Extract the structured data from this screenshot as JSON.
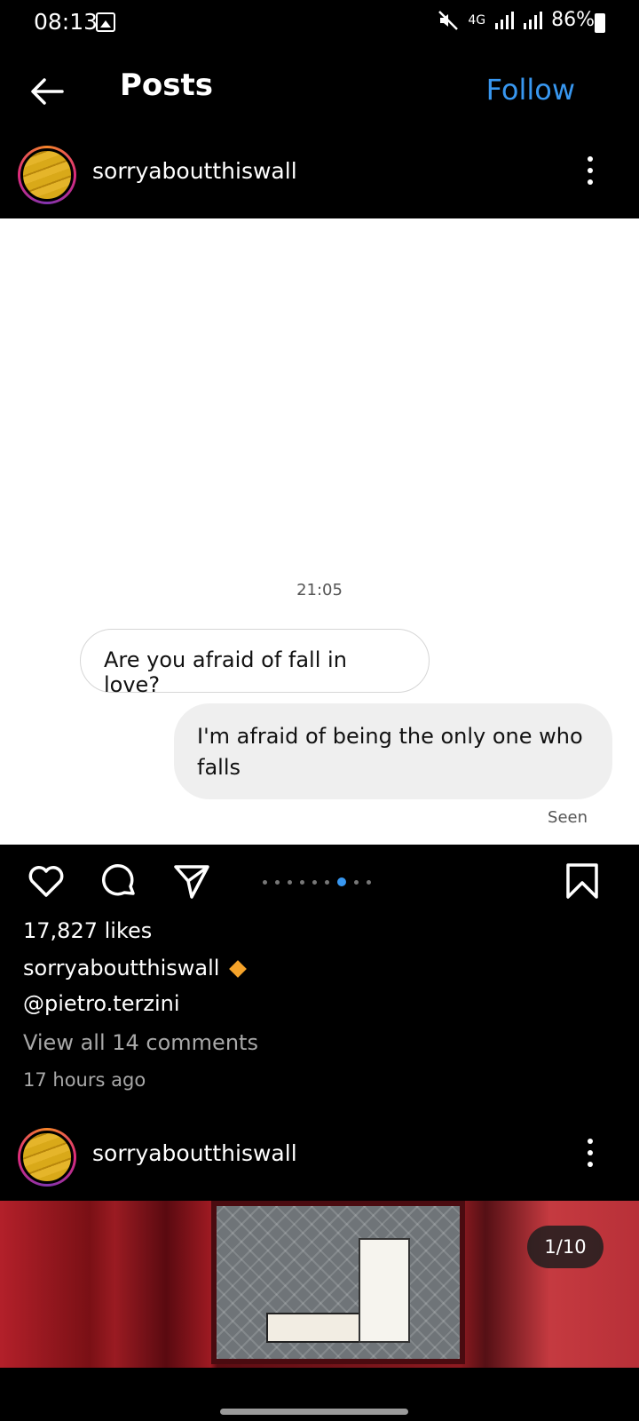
{
  "status_bar": {
    "time": "08:13",
    "network": "4G",
    "battery": "86%"
  },
  "header": {
    "title": "Posts",
    "follow_label": "Follow"
  },
  "post": {
    "username": "sorryaboutthiswall",
    "chat": {
      "time": "21:05",
      "message_left": "Are you afraid of fall in love?",
      "message_right": "I'm afraid of being the only one who falls",
      "seen": "Seen"
    },
    "likes": "17,827 likes",
    "caption_user": "sorryaboutthiswall",
    "caption_mention": "@pietro.terzini",
    "view_comments": "View all 14 comments",
    "time_ago": "17 hours ago",
    "carousel": {
      "count": 8,
      "active_index": 6
    }
  },
  "next_post": {
    "username": "sorryaboutthiswall",
    "counter": "1/10"
  },
  "colors": {
    "accent": "#3897f0",
    "background": "#000000"
  }
}
